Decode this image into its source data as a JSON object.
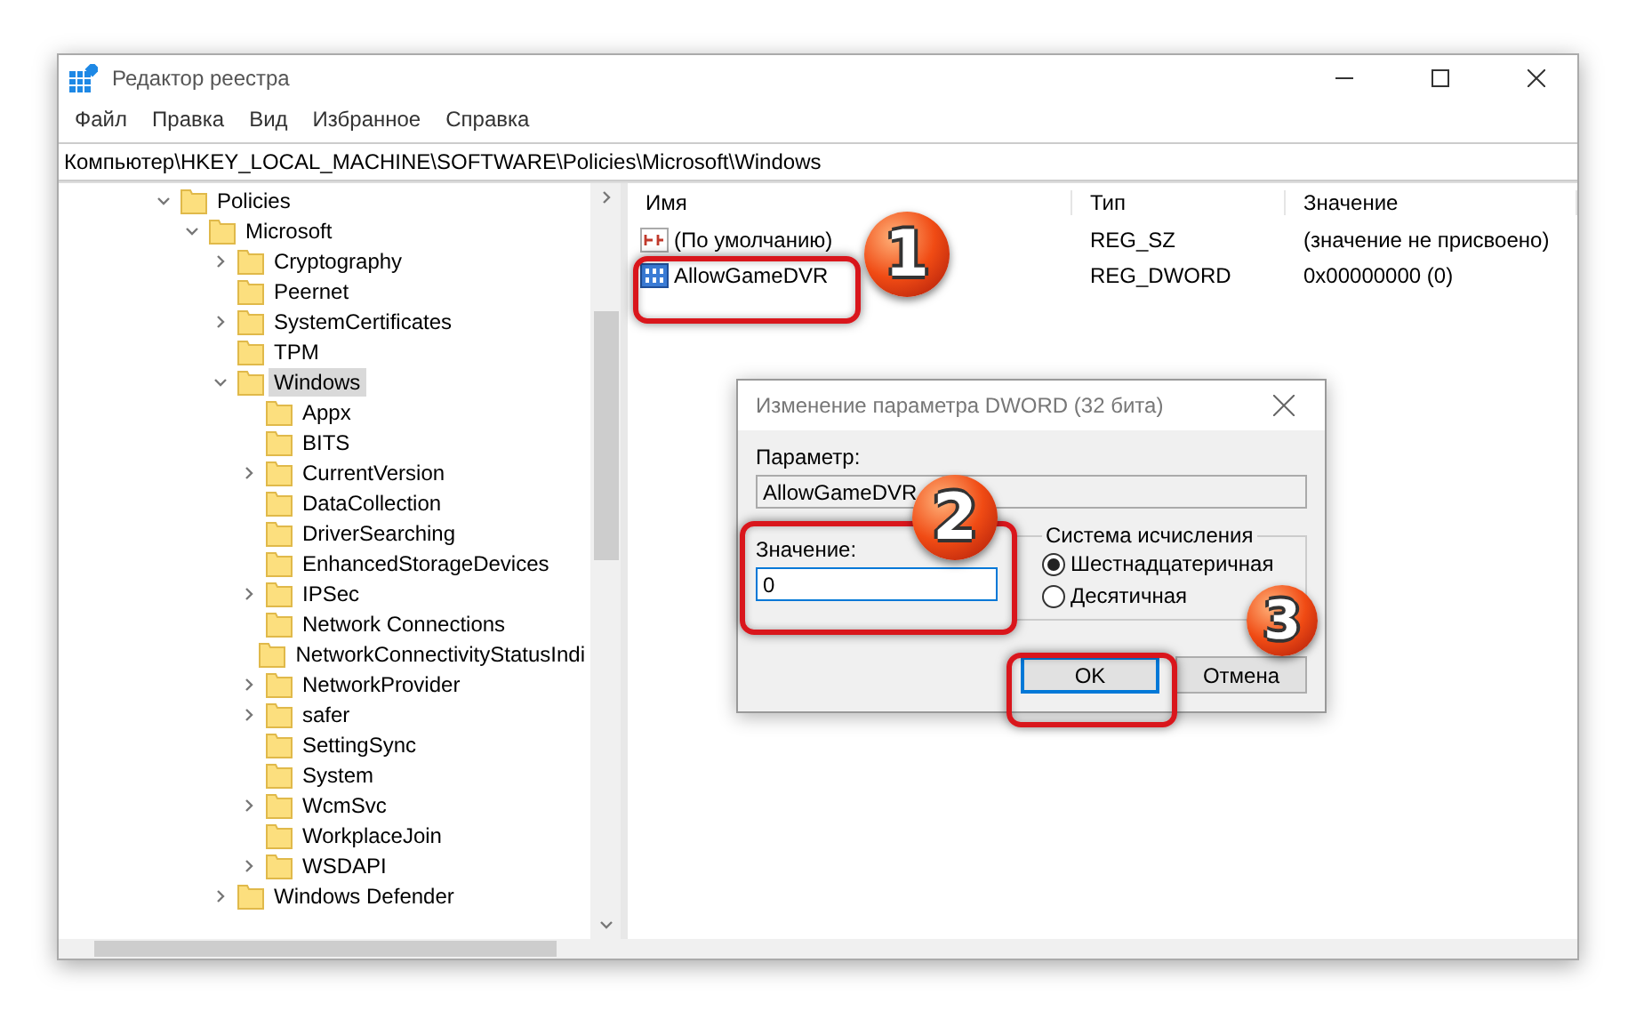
{
  "window": {
    "title": "Редактор реестра"
  },
  "menu": [
    "Файл",
    "Правка",
    "Вид",
    "Избранное",
    "Справка"
  ],
  "address": "Компьютер\\HKEY_LOCAL_MACHINE\\SOFTWARE\\Policies\\Microsoft\\Windows",
  "tree": [
    {
      "label": "Policies",
      "expandable": true,
      "expanded": true,
      "selected": false,
      "children": [
        {
          "label": "Microsoft",
          "expandable": true,
          "expanded": true,
          "selected": false,
          "children": [
            {
              "label": "Cryptography",
              "expandable": true,
              "expanded": false,
              "selected": false
            },
            {
              "label": "Peernet",
              "expandable": false,
              "expanded": false,
              "selected": false
            },
            {
              "label": "SystemCertificates",
              "expandable": true,
              "expanded": false,
              "selected": false
            },
            {
              "label": "TPM",
              "expandable": false,
              "expanded": false,
              "selected": false
            },
            {
              "label": "Windows",
              "expandable": true,
              "expanded": true,
              "selected": true,
              "children": [
                {
                  "label": "Appx",
                  "expandable": false,
                  "expanded": false,
                  "selected": false
                },
                {
                  "label": "BITS",
                  "expandable": false,
                  "expanded": false,
                  "selected": false
                },
                {
                  "label": "CurrentVersion",
                  "expandable": true,
                  "expanded": false,
                  "selected": false
                },
                {
                  "label": "DataCollection",
                  "expandable": false,
                  "expanded": false,
                  "selected": false
                },
                {
                  "label": "DriverSearching",
                  "expandable": false,
                  "expanded": false,
                  "selected": false
                },
                {
                  "label": "EnhancedStorageDevices",
                  "expandable": false,
                  "expanded": false,
                  "selected": false
                },
                {
                  "label": "IPSec",
                  "expandable": true,
                  "expanded": false,
                  "selected": false
                },
                {
                  "label": "Network Connections",
                  "expandable": false,
                  "expanded": false,
                  "selected": false
                },
                {
                  "label": "NetworkConnectivityStatusIndi",
                  "expandable": false,
                  "expanded": false,
                  "selected": false
                },
                {
                  "label": "NetworkProvider",
                  "expandable": true,
                  "expanded": false,
                  "selected": false
                },
                {
                  "label": "safer",
                  "expandable": true,
                  "expanded": false,
                  "selected": false
                },
                {
                  "label": "SettingSync",
                  "expandable": false,
                  "expanded": false,
                  "selected": false
                },
                {
                  "label": "System",
                  "expandable": false,
                  "expanded": false,
                  "selected": false
                },
                {
                  "label": "WcmSvc",
                  "expandable": true,
                  "expanded": false,
                  "selected": false
                },
                {
                  "label": "WorkplaceJoin",
                  "expandable": false,
                  "expanded": false,
                  "selected": false
                },
                {
                  "label": "WSDAPI",
                  "expandable": true,
                  "expanded": false,
                  "selected": false
                }
              ]
            },
            {
              "label": "Windows Defender",
              "expandable": true,
              "expanded": false,
              "selected": false
            }
          ]
        }
      ]
    }
  ],
  "list": {
    "columns": [
      "Имя",
      "Тип",
      "Значение"
    ],
    "rows": [
      {
        "kind": "string",
        "name": "(По умолчанию)",
        "type": "REG_SZ",
        "value": "(значение не присвоено)"
      },
      {
        "kind": "binary",
        "name": "AllowGameDVR",
        "type": "REG_DWORD",
        "value": "0x00000000 (0)"
      }
    ]
  },
  "dialog": {
    "title": "Изменение параметра DWORD (32 бита)",
    "param_label": "Параметр:",
    "param_value": "AllowGameDVR",
    "value_label": "Значение:",
    "value": "0",
    "group_title": "Система исчисления",
    "radios": [
      {
        "label": "Шестнадцатеричная",
        "selected": true
      },
      {
        "label": "Десятичная",
        "selected": false
      }
    ],
    "buttons": [
      {
        "label": "OK",
        "default": true
      },
      {
        "label": "Отмена",
        "default": false
      }
    ]
  },
  "callouts": [
    "1",
    "2",
    "3"
  ]
}
